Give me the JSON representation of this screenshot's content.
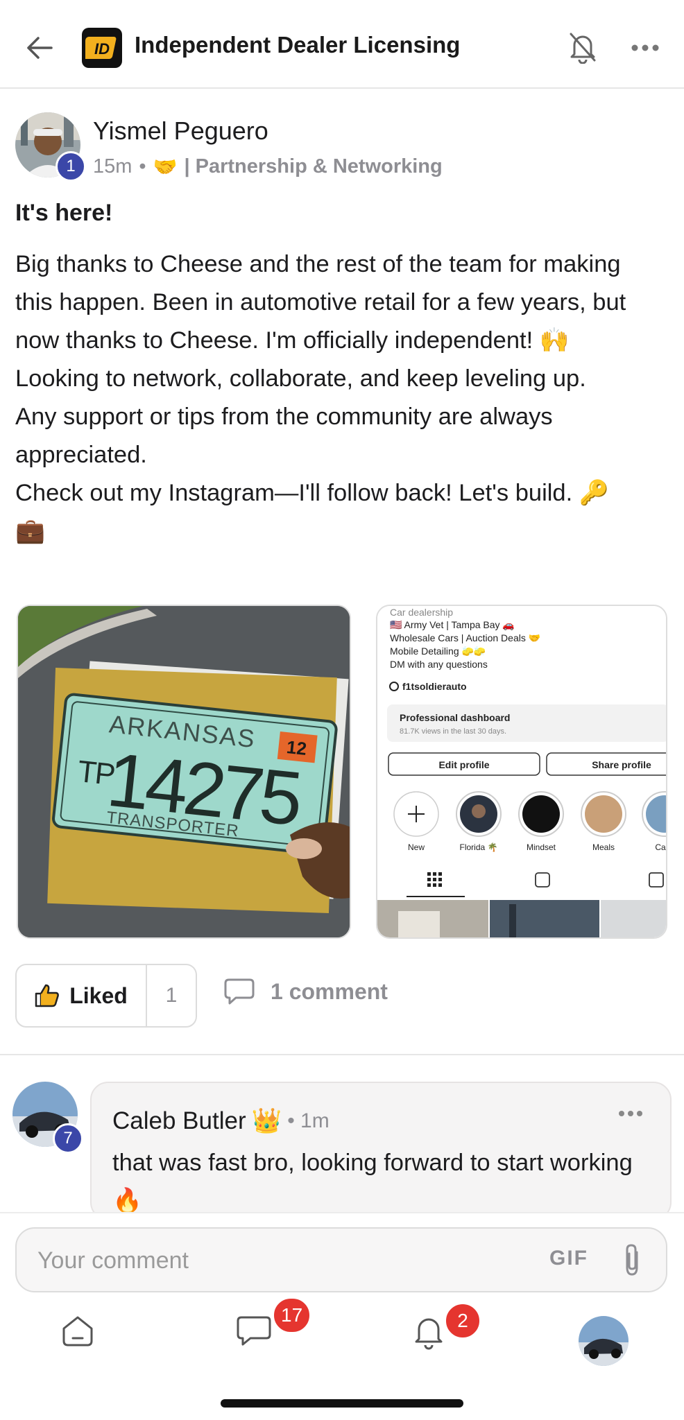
{
  "header": {
    "back_icon": "arrow-left-icon",
    "logo_text": "ID",
    "title": "Independent Dealer Licensing",
    "notification_icon": "bell-slash-icon",
    "more_icon": "ellipsis-icon"
  },
  "post": {
    "author": {
      "name": "Yismel Peguero",
      "level": "1"
    },
    "time": "15m",
    "separator": "•",
    "category_emoji": "🤝",
    "category": "| Partnership & Networking",
    "title": "It's here!",
    "body_lines": [
      "Big thanks to Cheese and the rest of the team for making",
      "this happen. Been in automotive retail for a few years, but",
      "now thanks to Cheese. I'm officially independent! 🙌",
      "Looking to network, collaborate, and keep leveling up.",
      "Any support or tips from the community are always",
      "appreciated.",
      "Check out my Instagram—I'll follow back! Let's build. 🔑",
      "💼"
    ],
    "images": {
      "plate": {
        "state": "ARKANSAS",
        "sticker": "12",
        "side_letters": "TP",
        "number": "14275",
        "type": "TRANSPORTER"
      },
      "instagram": {
        "category": "Car dealership",
        "bio_lines": [
          "🇺🇸 Army Vet | Tampa Bay 🚗",
          "Wholesale Cars | Auction Deals 🤝",
          "Mobile Detailing 🧽🧽",
          "DM with any questions"
        ],
        "threads_handle": "f1tsoldierauto",
        "dashboard_title": "Professional dashboard",
        "dashboard_sub": "81.7K views in the last 30 days.",
        "edit_profile": "Edit profile",
        "share_profile": "Share profile",
        "highlights": [
          "New",
          "Florida 🌴",
          "Mindset",
          "Meals",
          "Ca"
        ]
      }
    },
    "actions": {
      "liked_label": "Liked",
      "like_count": "1",
      "comments_label": "1 comment"
    }
  },
  "comment": {
    "author": "Caleb Butler",
    "author_emoji": "👑",
    "level": "7",
    "time": "• 1m",
    "text": "that was fast bro, looking forward to start working 🔥"
  },
  "composer": {
    "placeholder": "Your comment",
    "gif_label": "GIF",
    "attach_icon": "paperclip-icon"
  },
  "bottom_nav": {
    "home_icon": "home-icon",
    "chat_icon": "chat-bubble-icon",
    "chat_badge": "17",
    "notifications_icon": "bell-icon",
    "notifications_badge": "2"
  },
  "colors": {
    "badge_red": "#e5352f",
    "level_blue": "#3b47a8",
    "muted_gray": "#8e8e93"
  }
}
